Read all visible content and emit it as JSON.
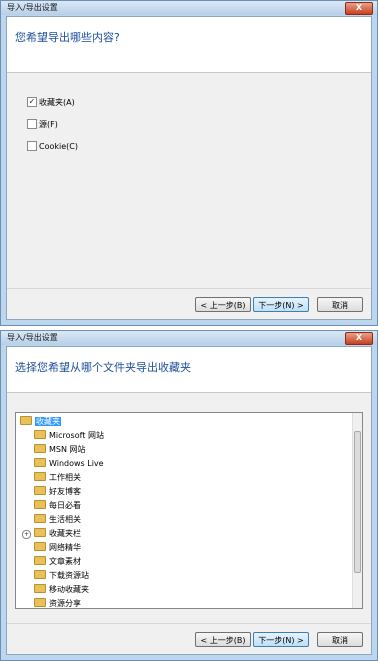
{
  "dialog1": {
    "title": "导入/导出设置",
    "close": "X",
    "question": "您希望导出哪些内容?",
    "options": [
      {
        "label": "收藏夹(A)",
        "checked": true
      },
      {
        "label": "源(F)",
        "checked": false
      },
      {
        "label": "Cookie(C)",
        "checked": false
      }
    ],
    "buttons": {
      "back": "< 上一步(B)",
      "next": "下一步(N) >",
      "cancel": "取消"
    }
  },
  "dialog2": {
    "title": "导入/导出设置",
    "close": "X",
    "question": "选择您希望从哪个文件夹导出收藏夹",
    "tree": [
      "收藏夹",
      "Microsoft 网站",
      "MSN 网站",
      "Windows Live",
      "工作相关",
      "好友博客",
      "每日必看",
      "生活相关",
      "收藏夹栏",
      "网络精华",
      "文章素材",
      "下载资源站",
      "移动收藏夹",
      "资源分享"
    ],
    "buttons": {
      "back": "< 上一步(B)",
      "next": "下一步(N) >",
      "cancel": "取消"
    }
  }
}
